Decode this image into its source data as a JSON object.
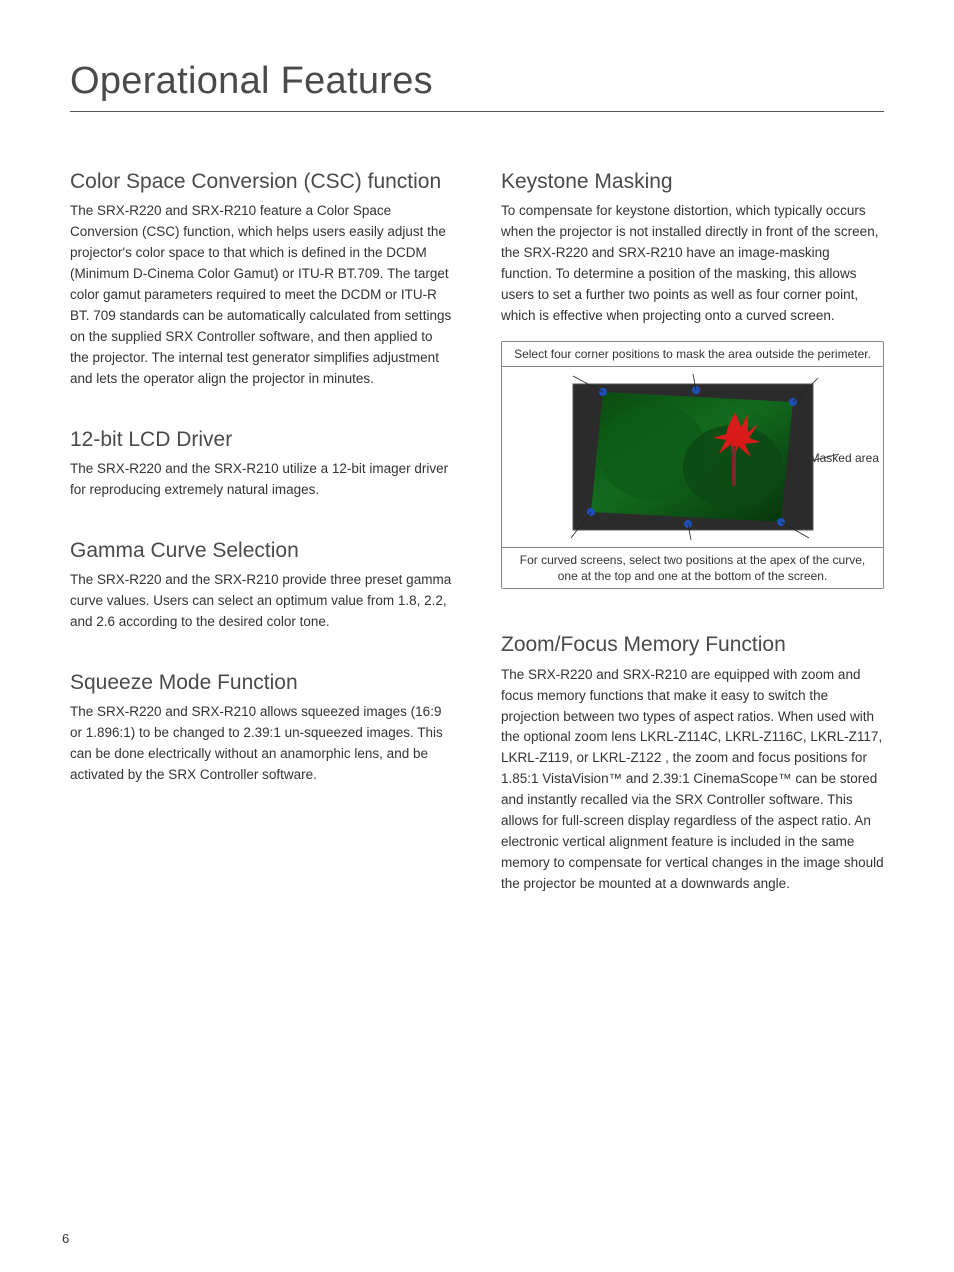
{
  "page_title": "Operational Features",
  "page_number": "6",
  "left": {
    "csc": {
      "heading": "Color Space Conversion (CSC) function",
      "body": "The SRX-R220 and SRX-R210 feature a Color Space Conversion (CSC) function, which helps users easily adjust the projector's color space to that which is defined in the DCDM (Minimum D-Cinema Color Gamut) or ITU-R BT.709. The target color gamut parameters required to meet the DCDM or ITU-R BT. 709 standards can be automatically calculated from settings on the supplied SRX Controller software, and then applied to the projector.  The internal test generator simplifies adjustment and lets the operator align the projector in minutes."
    },
    "driver": {
      "heading": "12-bit LCD Driver",
      "body": "The SRX-R220 and the SRX-R210 utilize a 12-bit imager driver for reproducing extremely natural images."
    },
    "gamma": {
      "heading": "Gamma Curve Selection",
      "body": "The SRX-R220 and the SRX-R210 provide three preset gamma curve values.  Users can select an optimum value from 1.8, 2.2, and 2.6 according to the desired color tone."
    },
    "squeeze": {
      "heading": "Squeeze Mode Function",
      "body": "The SRX-R220 and SRX-R210 allows squeezed images (16:9 or 1.896:1) to be changed to 2.39:1 un-squeezed images. This can be done electrically without an anamorphic lens, and be activated by the SRX Controller software."
    }
  },
  "right": {
    "keystone": {
      "heading": "Keystone Masking",
      "body": "To compensate for keystone distortion, which typically occurs when the projector is not installed directly in front of the screen, the SRX-R220 and SRX-R210 have an image-masking function.  To determine a position of the masking, this allows users to set a further two points as well as four corner point, which is effective when projecting onto a curved screen.",
      "figure_top": "Select four corner positions to mask the area outside the perimeter.",
      "figure_label": "Masked area",
      "figure_bottom": "For curved screens, select two positions at the apex of the curve, one at the top and one at the bottom of the screen."
    },
    "zoom": {
      "heading": "Zoom/Focus Memory Function",
      "body": "The SRX-R220 and SRX-R210 are equipped with zoom and focus memory functions that make it easy to switch the projection between two types of aspect ratios. When used with the optional zoom lens LKRL-Z114C, LKRL-Z116C, LKRL-Z117, LKRL-Z119, or LKRL-Z122 , the zoom and focus positions for 1.85:1 VistaVision™ and 2.39:1 CinemaScope™ can be stored and instantly recalled via the SRX Controller software.  This allows for full-screen display regardless of the aspect ratio.  An electronic vertical alignment feature is included in the same memory to compensate for vertical changes in the image should the projector be mounted at a downwards angle."
    }
  }
}
